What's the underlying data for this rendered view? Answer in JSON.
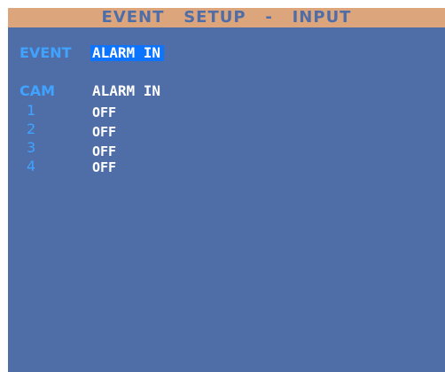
{
  "title": "EVENT   SETUP   -   INPUT",
  "event": {
    "label": "EVENT",
    "value": "ALARM IN"
  },
  "table": {
    "cam_header": "CAM",
    "alarm_header": "ALARM IN",
    "rows": [
      {
        "cam": "1",
        "alarm": "OFF"
      },
      {
        "cam": "2",
        "alarm": "OFF"
      },
      {
        "cam": "3",
        "alarm": "OFF"
      },
      {
        "cam": "4",
        "alarm": "OFF"
      }
    ]
  },
  "colors": {
    "background": "#4f6ea8",
    "title_bar": "#dca57c",
    "label": "#3fa3ff",
    "highlight": "#0c74ff",
    "value": "#ffffff"
  }
}
